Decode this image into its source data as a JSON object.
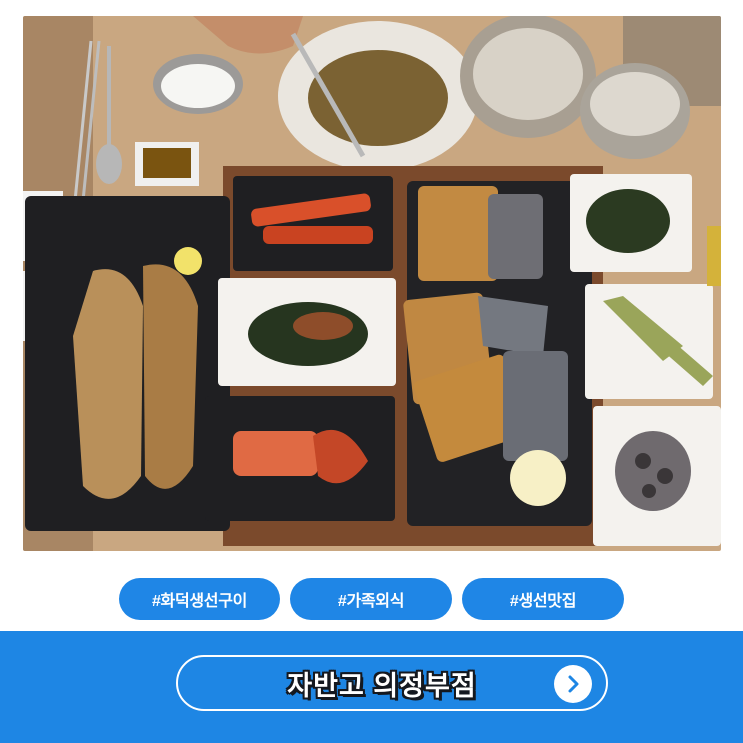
{
  "photo": {
    "icon": "restaurant-meal-photo",
    "colors": {
      "table": "#c9a781",
      "tray": "#7b4a2c",
      "black_plate": "#1f1f22",
      "white_plate": "#f4f2ee",
      "kimchi": "#d9502a",
      "fish": "#b9905a"
    }
  },
  "tags": [
    "#화덕생선구이",
    "#가족외식",
    "#생선맛집"
  ],
  "cta": {
    "label": "자반고 의정부점",
    "icon": "chevron-right-icon"
  },
  "colors": {
    "accent": "#1e86e4",
    "tag_bg": "#1f86e6",
    "text_outline": "#14181f"
  }
}
